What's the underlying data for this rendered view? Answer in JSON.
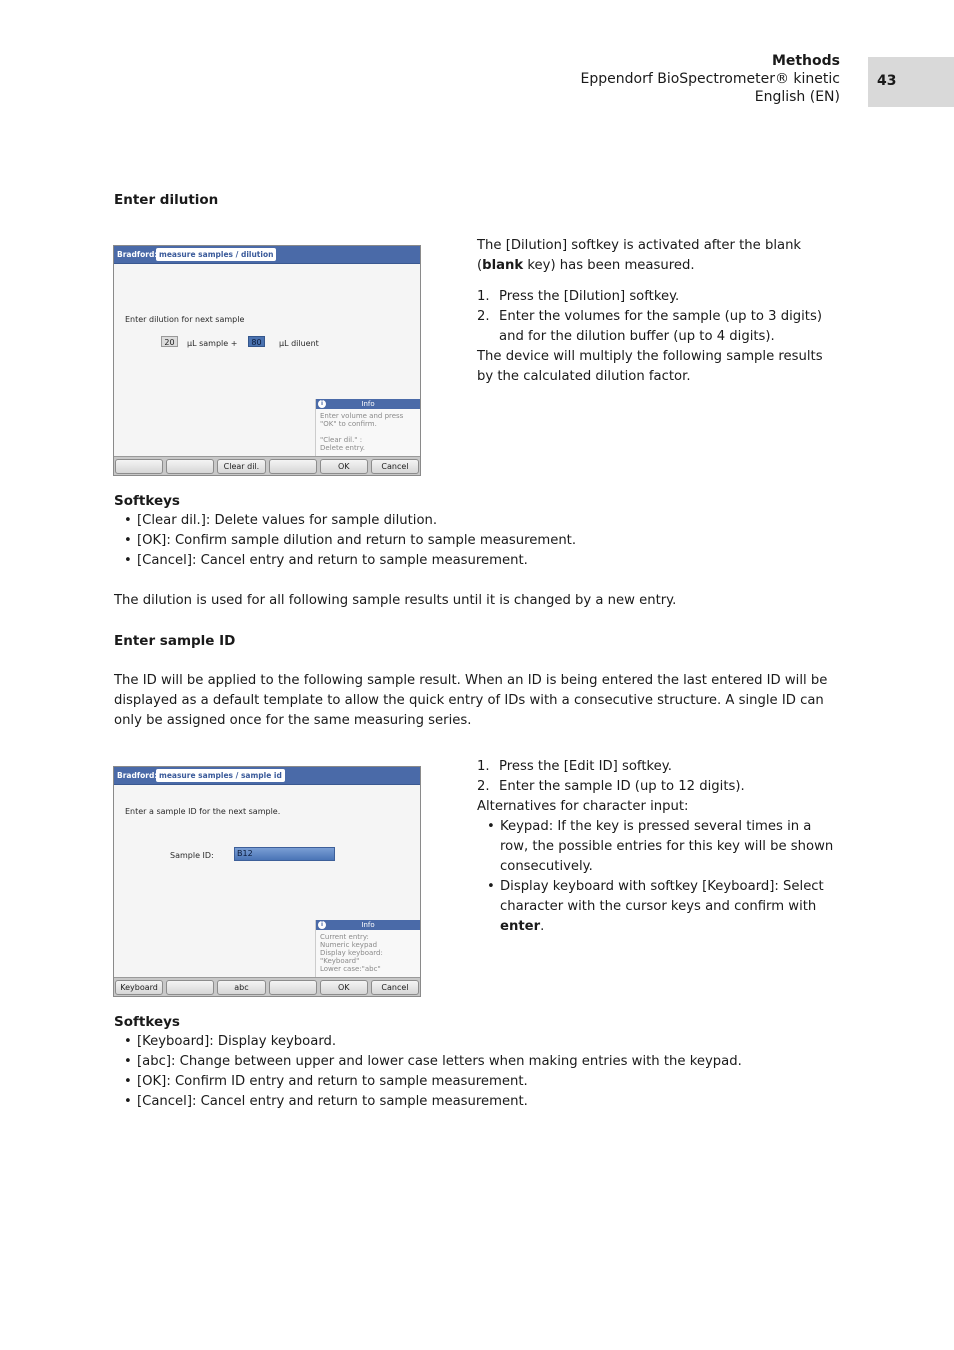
{
  "header": {
    "section": "Methods",
    "product": "Eppendorf BioSpectrometer® kinetic",
    "language": "English (EN)",
    "page_number": "43"
  },
  "dilution": {
    "heading": "Enter dilution",
    "screen": {
      "app": "Bradford:",
      "breadcrumb": "measure samples / dilution",
      "prompt": "Enter dilution for next sample",
      "sample_volume": "20",
      "sample_unit": "µL sample +",
      "diluent_volume": "80",
      "diluent_unit": "µL diluent",
      "info_title": "Info",
      "info_lines": [
        "Enter volume and press",
        "\"OK\" to confirm.",
        "\"Clear dil.\" :",
        "Delete entry."
      ],
      "softkeys": [
        "",
        "",
        "Clear dil.",
        "",
        "OK",
        "Cancel"
      ]
    },
    "intro_1": "The [Dilution] softkey is activated after the blank",
    "intro_2_bold": "blank",
    "intro_2_rest": " key) has been measured.",
    "steps": [
      {
        "num": "1.",
        "text": "Press the [Dilution] softkey."
      },
      {
        "num": "2.",
        "text": "Enter the volumes for the sample (up to 3 digits) and for the dilution buffer (up to 4 digits)."
      }
    ],
    "outro": "The device will multiply the following sample results by the calculated dilution factor.",
    "softkeys_heading": "Softkeys",
    "softkeys_list": [
      "[Clear dil.]: Delete values for sample dilution.",
      "[OK]: Confirm sample dilution and return to sample measurement.",
      "[Cancel]: Cancel entry and return to sample measurement."
    ],
    "note": "The dilution is used for all following sample results until it is changed by a new entry."
  },
  "sample_id": {
    "heading": "Enter sample ID",
    "paragraph": "The ID will be applied to the following sample result. When an ID is being entered the last entered ID will be displayed as a default template to allow the quick entry of IDs with a consecutive structure. A single ID can only be assigned once for the same measuring series.",
    "screen": {
      "app": "Bradford:",
      "breadcrumb": "measure samples / sample id",
      "prompt": "Enter a sample ID for the next sample.",
      "field_label": "Sample ID:",
      "field_value": "B12",
      "info_title": "Info",
      "info_lines": [
        "Current entry:",
        "Numeric keypad",
        "Display keyboard:",
        "\"Keyboard\"",
        "Lower case:\"abc\""
      ],
      "softkeys": [
        "Keyboard",
        "",
        "abc",
        "",
        "OK",
        "Cancel"
      ]
    },
    "steps": [
      {
        "num": "1.",
        "text": "Press the [Edit ID] softkey."
      },
      {
        "num": "2.",
        "text": "Enter the sample ID (up to 12 digits)."
      }
    ],
    "alternatives_label": "Alternatives for character input:",
    "alternatives": [
      {
        "text": "Keypad: If the key is pressed several times in a row, the possible entries for this key will be shown consecutively."
      },
      {
        "text": "Display keyboard with softkey [Keyboard]: Select character with the cursor keys and confirm with ",
        "bold": "enter",
        "tail": "."
      }
    ],
    "softkeys_heading": "Softkeys",
    "softkeys_list": [
      "[Keyboard]: Display keyboard.",
      "[abc]: Change between upper and lower case letters when making entries with the keypad.",
      "[OK]: Confirm ID entry and return to sample measurement.",
      "[Cancel]: Cancel entry and return to sample measurement."
    ]
  }
}
